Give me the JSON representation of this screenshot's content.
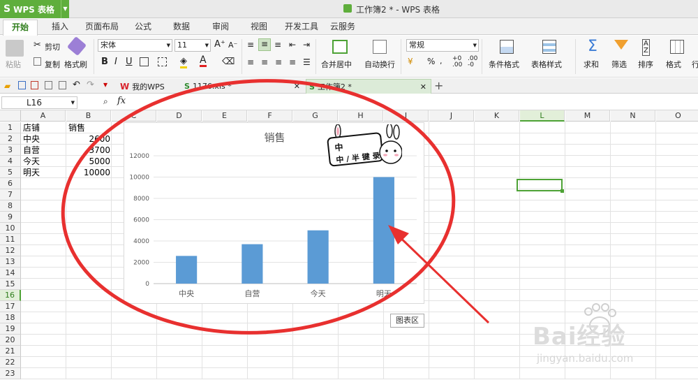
{
  "app": {
    "name": "WPS 表格",
    "window_title": "工作簿2 * - WPS 表格"
  },
  "menu_tabs": [
    "开始",
    "插入",
    "页面布局",
    "公式",
    "数据",
    "审阅",
    "视图",
    "开发工具",
    "云服务"
  ],
  "ribbon": {
    "paste": "粘贴",
    "cut": "剪切",
    "copy": "复制",
    "format_painter": "格式刷",
    "font_name": "宋体",
    "font_size": "11",
    "number_format": "常规",
    "merge_center": "合并居中",
    "wrap_text": "自动换行",
    "conditional_format": "条件格式",
    "table_style": "表格样式",
    "sum": "求和",
    "filter": "筛选",
    "sort": "排序",
    "format": "格式",
    "row_col": "行"
  },
  "doc_tabs": [
    {
      "label": "我的WPS"
    },
    {
      "label": "1176.xls *"
    },
    {
      "label": "工作簿2 *"
    }
  ],
  "formula_bar": {
    "name_box": "L16",
    "fx": "fx"
  },
  "columns": [
    "A",
    "B",
    "C",
    "D",
    "E",
    "F",
    "G",
    "H",
    "I",
    "J",
    "K",
    "L",
    "M",
    "N",
    "O"
  ],
  "rows": [
    "1",
    "2",
    "3",
    "4",
    "5",
    "6",
    "7",
    "8",
    "9",
    "10",
    "11",
    "12",
    "13",
    "14",
    "15",
    "16",
    "17",
    "18",
    "19",
    "20",
    "21",
    "22",
    "23"
  ],
  "cells": {
    "a1": "店铺",
    "b1": "销售",
    "a2": "中央",
    "b2": "2600",
    "a3": "自营",
    "b3": "3700",
    "a4": "今天",
    "b4": "5000",
    "a5": "明天",
    "b5": "10000"
  },
  "tooltip": "图表区",
  "sticker_text": "中 / 半 键 录 设",
  "watermark": {
    "brand": "Bai经验",
    "url": "jingyan.baidu.com"
  },
  "colors": {
    "accent": "#4da235",
    "bar": "#5b9bd5",
    "annotation": "#e8302f"
  },
  "chart_data": {
    "type": "bar",
    "title": "销售",
    "categories": [
      "中央",
      "自营",
      "今天",
      "明天"
    ],
    "values": [
      2600,
      3700,
      5000,
      10000
    ],
    "ylim": [
      0,
      12000
    ],
    "yticks": [
      0,
      2000,
      4000,
      6000,
      8000,
      10000,
      12000
    ],
    "grid": true,
    "legend": "none"
  }
}
